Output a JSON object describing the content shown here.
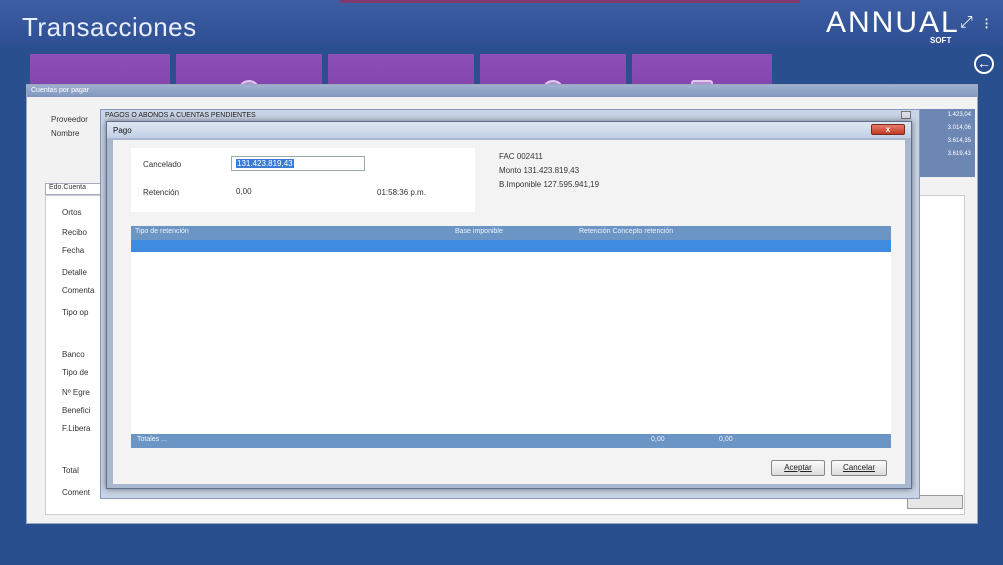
{
  "app": {
    "title": "Transacciones",
    "logo_text": "ANNUAL",
    "logo_sub": "SOFT",
    "minimize_glyph": "⤢",
    "menu_glyph": "⁝",
    "back_glyph": "←"
  },
  "colors": {
    "header_bg": "#3d5ea3",
    "tile_purple": "#8e4fb8",
    "grid_header": "#6b95c4",
    "selected_row": "#3f8be0",
    "close_red": "#c23a25"
  },
  "background_window": {
    "title": "Cuentas por pagar",
    "labels": [
      "Proveedor",
      "Nombre",
      "Edo.Cuenta",
      "Ortos",
      "Recibo",
      "Fecha",
      "Detalle",
      "Comenta",
      "Tipo op",
      "Banco",
      "Tipo de",
      "Nº Egre",
      "Benefici",
      "F.Libera",
      "Total",
      "Coment"
    ],
    "right_values": [
      "1.423,04",
      "3.014,06",
      "3.614,35",
      "3.619,43"
    ]
  },
  "provider_window": {
    "title": "PAGOS O ABONOS A CUENTAS PENDIENTES"
  },
  "dialog": {
    "title": "Pago",
    "close_label": "x",
    "form": {
      "cancelado_label": "Cancelado",
      "cancelado_value": "131.423.819,43",
      "retencion_label": "Retención",
      "retencion_value": "0,00",
      "time": "01:58:36 p.m."
    },
    "info": {
      "fac": "FAC  002411",
      "monto": "Monto 131.423.819,43",
      "bimponible": "B.Imponible 127.595.941,19"
    },
    "grid": {
      "columns": [
        "Tipo de retención",
        "Base imponible",
        "Retención Concepto retención"
      ],
      "totals_label": "Totales ...",
      "totals": [
        "0,00",
        "0,00"
      ]
    },
    "buttons": {
      "accept": "Aceptar",
      "cancel": "Cancelar"
    }
  }
}
